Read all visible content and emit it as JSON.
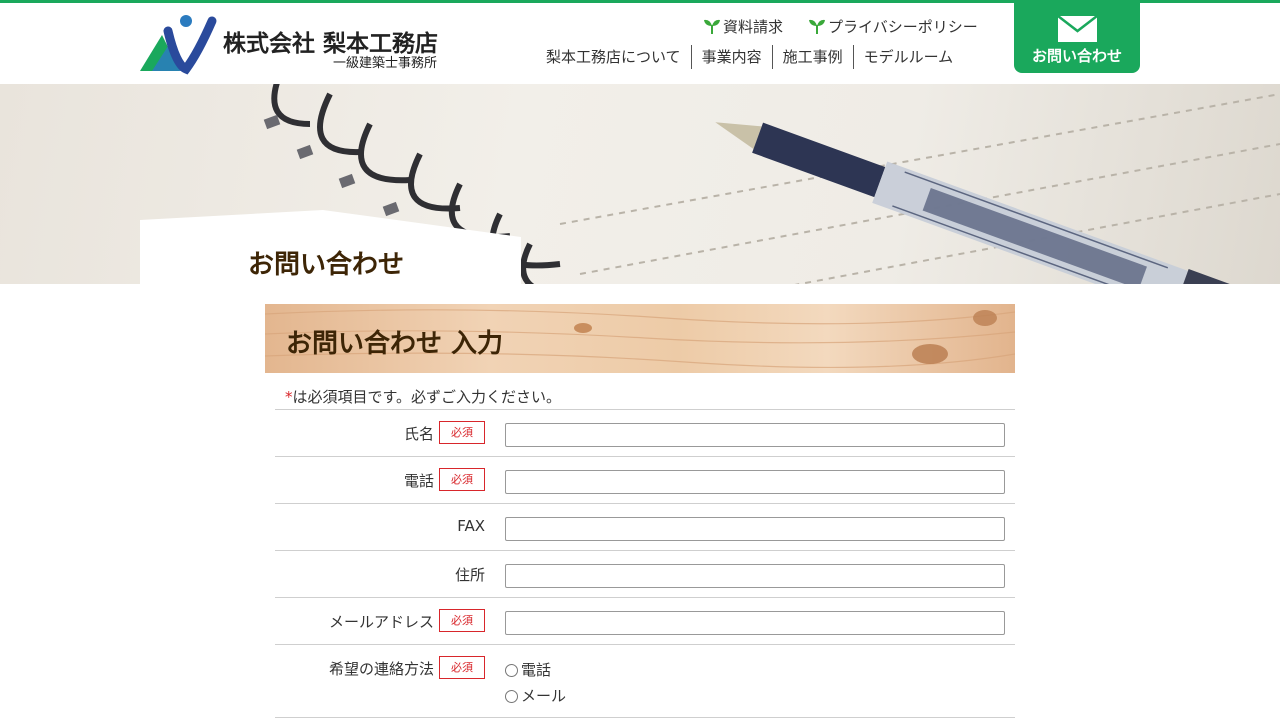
{
  "header": {
    "company": "株式会社 梨本工務店",
    "subtitle": "一級建築士事務所",
    "util_links": [
      "資料請求",
      "プライバシーポリシー"
    ],
    "nav": [
      "梨本工務店について",
      "事業内容",
      "施工事例",
      "モデルルーム"
    ],
    "contact_label": "お問い合わせ"
  },
  "hero": {
    "title": "お問い合わせ"
  },
  "section": {
    "title": "お問い合わせ 入力",
    "note_mark": "*",
    "note": "は必須項目です。必ずご入力ください。"
  },
  "form": {
    "required_badge": "必須",
    "fields": [
      {
        "label": "氏名",
        "required": true,
        "value": ""
      },
      {
        "label": "電話",
        "required": true,
        "value": ""
      },
      {
        "label": "FAX",
        "required": false,
        "value": ""
      },
      {
        "label": "住所",
        "required": false,
        "value": ""
      },
      {
        "label": "メールアドレス",
        "required": true,
        "value": ""
      }
    ],
    "contact_method": {
      "label": "希望の連絡方法",
      "required": true,
      "options": [
        "電話",
        "メール"
      ]
    }
  },
  "colors": {
    "brand_green": "#1aa85c",
    "required_red": "#d8262b",
    "heading_brown": "#3d2506"
  }
}
